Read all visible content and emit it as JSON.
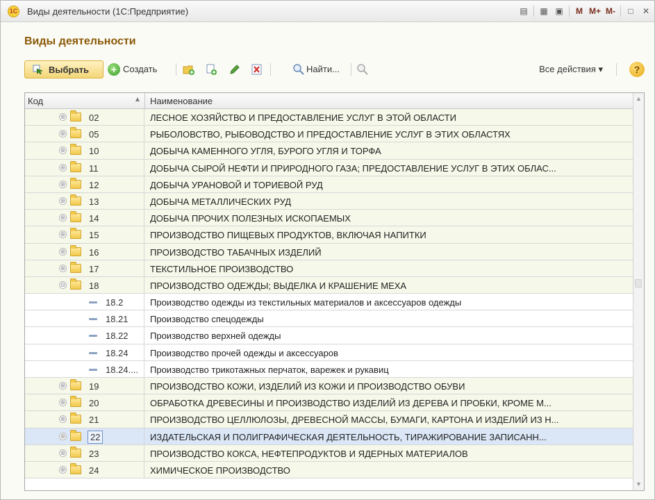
{
  "window": {
    "title": "Виды деятельности (1С:Предприятие)",
    "logo": "1С",
    "tools": [
      "M",
      "M+",
      "M-"
    ]
  },
  "form": {
    "title": "Виды деятельности"
  },
  "toolbar": {
    "select_label": "Выбрать",
    "create_label": "Создать",
    "find_label": "Найти...",
    "all_actions_label": "Все действия ▾",
    "help_label": "?"
  },
  "grid": {
    "columns": [
      "Код",
      "Наименование"
    ],
    "rows": [
      {
        "code": "02",
        "name": "ЛЕСНОЕ ХОЗЯЙСТВО И ПРЕДОСТАВЛЕНИЕ УСЛУГ В ЭТОЙ ОБЛАСТИ",
        "type": "group",
        "expander": "⊕"
      },
      {
        "code": "05",
        "name": "РЫБОЛОВСТВО, РЫБОВОДСТВО И ПРЕДОСТАВЛЕНИЕ УСЛУГ В ЭТИХ ОБЛАСТЯХ",
        "type": "group",
        "expander": "⊕"
      },
      {
        "code": "10",
        "name": "ДОБЫЧА КАМЕННОГО УГЛЯ, БУРОГО УГЛЯ И ТОРФА",
        "type": "group",
        "expander": "⊕"
      },
      {
        "code": "11",
        "name": "ДОБЫЧА СЫРОЙ НЕФТИ И ПРИРОДНОГО ГАЗА; ПРЕДОСТАВЛЕНИЕ УСЛУГ В ЭТИХ ОБЛАС...",
        "type": "group",
        "expander": "⊕"
      },
      {
        "code": "12",
        "name": "ДОБЫЧА УРАНОВОЙ И ТОРИЕВОЙ РУД",
        "type": "group",
        "expander": "⊕"
      },
      {
        "code": "13",
        "name": "ДОБЫЧА МЕТАЛЛИЧЕСКИХ РУД",
        "type": "group",
        "expander": "⊕"
      },
      {
        "code": "14",
        "name": "ДОБЫЧА ПРОЧИХ ПОЛЕЗНЫХ ИСКОПАЕМЫХ",
        "type": "group",
        "expander": "⊕"
      },
      {
        "code": "15",
        "name": "ПРОИЗВОДСТВО ПИЩЕВЫХ ПРОДУКТОВ, ВКЛЮЧАЯ НАПИТКИ",
        "type": "group",
        "expander": "⊕"
      },
      {
        "code": "16",
        "name": "ПРОИЗВОДСТВО ТАБАЧНЫХ ИЗДЕЛИЙ",
        "type": "group",
        "expander": "⊕"
      },
      {
        "code": "17",
        "name": "ТЕКСТИЛЬНОЕ ПРОИЗВОДСТВО",
        "type": "group",
        "expander": "⊕"
      },
      {
        "code": "18",
        "name": "ПРОИЗВОДСТВО ОДЕЖДЫ; ВЫДЕЛКА И КРАШЕНИЕ МЕХА",
        "type": "group",
        "expander": "⊖"
      },
      {
        "code": "18.2",
        "name": "Производство одежды из текстильных материалов и аксессуаров одежды",
        "type": "leaf"
      },
      {
        "code": "18.21",
        "name": "Производство спецодежды",
        "type": "leaf"
      },
      {
        "code": "18.22",
        "name": "Производство верхней одежды",
        "type": "leaf"
      },
      {
        "code": "18.24",
        "name": "Производство прочей одежды и аксессуаров",
        "type": "leaf"
      },
      {
        "code": "18.24....",
        "name": "Производство трикотажных перчаток, варежек и рукавиц",
        "type": "leaf"
      },
      {
        "code": "19",
        "name": "ПРОИЗВОДСТВО КОЖИ, ИЗДЕЛИЙ ИЗ КОЖИ И ПРОИЗВОДСТВО ОБУВИ",
        "type": "group",
        "expander": "⊕"
      },
      {
        "code": "20",
        "name": "ОБРАБОТКА ДРЕВЕСИНЫ И ПРОИЗВОДСТВО ИЗДЕЛИЙ ИЗ ДЕРЕВА И ПРОБКИ, КРОМЕ М...",
        "type": "group",
        "expander": "⊕"
      },
      {
        "code": "21",
        "name": "ПРОИЗВОДСТВО ЦЕЛЛЮЛОЗЫ, ДРЕВЕСНОЙ МАССЫ, БУМАГИ, КАРТОНА И ИЗДЕЛИЙ ИЗ Н...",
        "type": "group",
        "expander": "⊕"
      },
      {
        "code": "22",
        "name": "ИЗДАТЕЛЬСКАЯ И ПОЛИГРАФИЧЕСКАЯ ДЕЯТЕЛЬНОСТЬ, ТИРАЖИРОВАНИЕ ЗАПИСАНН...",
        "type": "group",
        "expander": "⊕",
        "selected": true
      },
      {
        "code": "23",
        "name": "ПРОИЗВОДСТВО КОКСА, НЕФТЕПРОДУКТОВ И ЯДЕРНЫХ МАТЕРИАЛОВ",
        "type": "group",
        "expander": "⊕"
      },
      {
        "code": "24",
        "name": "ХИМИЧЕСКОЕ ПРОИЗВОДСТВО",
        "type": "group",
        "expander": "⊕"
      }
    ]
  },
  "colors": {
    "accent_title": "#8a5a08",
    "group_row_bg": "#f6f8e9",
    "selected_row_bg": "#dbe7f7"
  }
}
